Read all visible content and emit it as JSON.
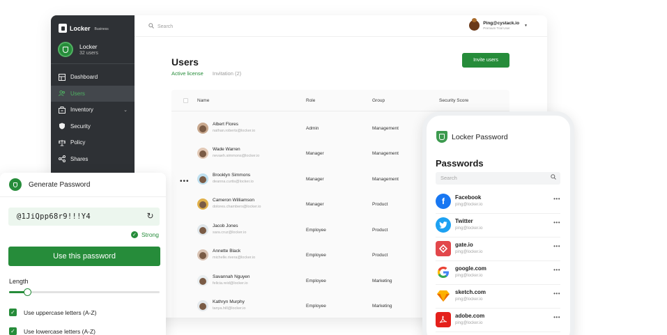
{
  "app": {
    "brand": {
      "name": "Locker",
      "sub": "Business"
    },
    "org": {
      "name": "Locker",
      "count": "32 users"
    },
    "nav": [
      {
        "label": "Dashboard",
        "icon": "dashboard-icon"
      },
      {
        "label": "Users",
        "icon": "users-icon"
      },
      {
        "label": "Inventory",
        "icon": "inventory-icon"
      },
      {
        "label": "Security",
        "icon": "security-icon"
      },
      {
        "label": "Policy",
        "icon": "policy-icon"
      },
      {
        "label": "Shares",
        "icon": "shares-icon"
      }
    ],
    "search_placeholder": "Search",
    "profile": {
      "email": "Ping@cystack.io",
      "plan": "Premium Trial User"
    },
    "page_title": "Users",
    "tabs": [
      "Active license",
      "Invitation (2)"
    ],
    "invite_label": "Invite users",
    "table": {
      "headers": [
        "Name",
        "Role",
        "Group",
        "Security Score"
      ],
      "rows": [
        {
          "name": "Albert Flores",
          "email": "nathan.roberts@locker.io",
          "role": "Admin",
          "group": "Management"
        },
        {
          "name": "Wade Warren",
          "email": "nevaeh.simmons@locker.io",
          "role": "Manager",
          "group": "Management"
        },
        {
          "name": "Brooklyn Simmons",
          "email": "deanna.curtis@locker.io",
          "role": "Manager",
          "group": "Management"
        },
        {
          "name": "Cameron Williamson",
          "email": "dolores.chambers@locker.io",
          "role": "Manager",
          "group": "Product"
        },
        {
          "name": "Jacob Jones",
          "email": "sara.cruz@locker.io",
          "role": "Employee",
          "group": "Product"
        },
        {
          "name": "Annette Black",
          "email": "michelle.rivera@locker.io",
          "role": "Employee",
          "group": "Product"
        },
        {
          "name": "Savannah Nguyen",
          "email": "felicia.reid@locker.io",
          "role": "Employee",
          "group": "Marketing"
        },
        {
          "name": "Kathryn Murphy",
          "email": "tanya.hill@locker.io",
          "role": "Employee",
          "group": "Marketing"
        }
      ]
    }
  },
  "generator": {
    "title": "Generate Password",
    "password": "@1JiQpp68r9!!!Y4",
    "strength": "Strong",
    "use_label": "Use this password",
    "length_label": "Length",
    "length_fraction": 0.12,
    "options": [
      {
        "label": "Use uppercase letters (A-Z)",
        "checked": true
      },
      {
        "label": "Use lowercase letters (A-Z)",
        "checked": true
      }
    ]
  },
  "phone": {
    "brand": "Locker Password",
    "title": "Passwords",
    "search_placeholder": "Search",
    "items": [
      {
        "name": "Facebook",
        "email": "ping@locker.io",
        "icon": "facebook-icon",
        "color": "#1877f2"
      },
      {
        "name": "Twitter",
        "email": "ping@locker.io",
        "icon": "twitter-icon",
        "color": "#1da1f2"
      },
      {
        "name": "gate.io",
        "email": "ping@locker.io",
        "icon": "gateio-icon",
        "color": "#e2474b"
      },
      {
        "name": "google.com",
        "email": "ping@locker.io",
        "icon": "google-icon",
        "color": "#ffffff"
      },
      {
        "name": "sketch.com",
        "email": "ping@locker.io",
        "icon": "sketch-icon",
        "color": "#f7b500"
      },
      {
        "name": "adobe.com",
        "email": "ping@locker.io",
        "icon": "adobe-icon",
        "color": "#e4201b"
      }
    ]
  },
  "colors": {
    "accent": "#268c3a",
    "sidebar": "#2e3135"
  }
}
